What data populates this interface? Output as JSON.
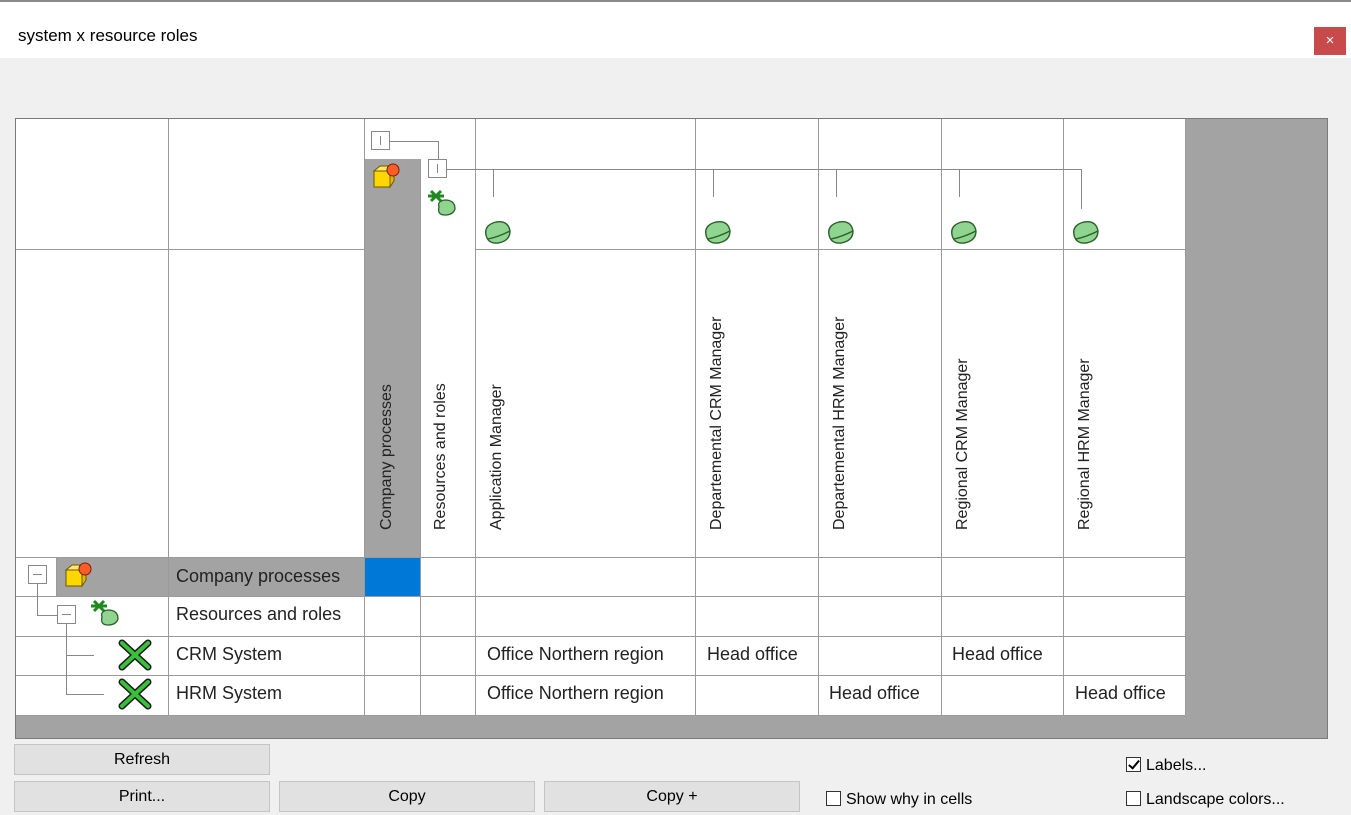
{
  "window": {
    "title": "system x resource roles",
    "close_glyph": "×"
  },
  "columns": [
    {
      "label": "Company processes",
      "icon": "process-group-icon"
    },
    {
      "label": "Resources and roles",
      "icon": "resource-group-icon"
    },
    {
      "label": "Application Manager",
      "icon": "role-icon"
    },
    {
      "label": "Departemental CRM Manager",
      "icon": "role-icon"
    },
    {
      "label": "Departemental HRM Manager",
      "icon": "role-icon"
    },
    {
      "label": "Regional CRM Manager",
      "icon": "role-icon"
    },
    {
      "label": "Regional HRM Manager",
      "icon": "role-icon"
    }
  ],
  "rows": [
    {
      "label": "Company processes",
      "icon": "process-group-icon",
      "cells": [
        "",
        "",
        "",
        "",
        "",
        "",
        ""
      ]
    },
    {
      "label": "Resources and roles",
      "icon": "resource-group-icon",
      "cells": [
        "",
        "",
        "",
        "",
        "",
        "",
        ""
      ]
    },
    {
      "label": "CRM System",
      "icon": "system-tool-icon",
      "cells": [
        "",
        "",
        "Office Northern region",
        "Head office",
        "",
        "Head office",
        ""
      ]
    },
    {
      "label": "HRM System",
      "icon": "system-tool-icon",
      "cells": [
        "",
        "",
        "Office Northern region",
        "",
        "Head office",
        "",
        "Head office"
      ]
    }
  ],
  "buttons": {
    "refresh": "Refresh",
    "print": "Print...",
    "copy": "Copy",
    "copy_plus": "Copy +"
  },
  "options": {
    "show_why": {
      "label": "Show why in cells",
      "checked": false
    },
    "labels": {
      "label": "Labels...",
      "checked": true
    },
    "landscape": {
      "label": "Landscape colors...",
      "checked": false
    }
  },
  "colors": {
    "selected_cell": "#0078d7",
    "header_highlight": "#a3a3a3",
    "role_icon": "#8fd48f",
    "process_icon": "#ffd700",
    "close_button": "#c84a4a"
  }
}
